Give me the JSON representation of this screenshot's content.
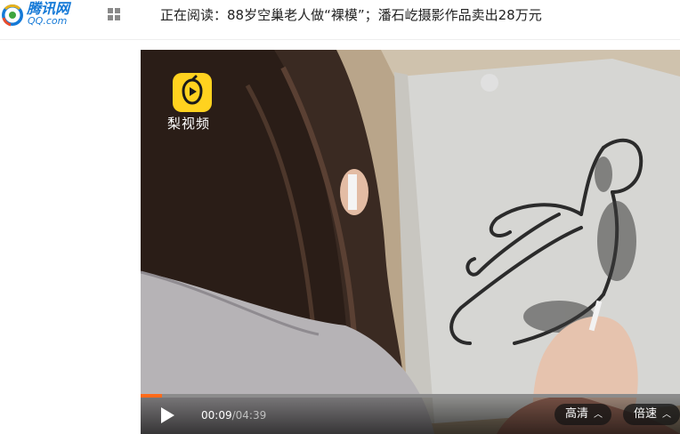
{
  "header": {
    "logo_text": "腾讯网",
    "logo_sub": "QQ.com",
    "menu_icon": "grid-icon",
    "reading_text": "正在阅读：88岁空巢老人做“裸模”；潘石屹摄影作品卖出28万元"
  },
  "video": {
    "brand_label": "梨视频",
    "progress_fraction": 0.039,
    "current_time": "00:09",
    "duration": "/04:39",
    "quality_label": "高清",
    "speed_label": "倍速",
    "play_icon": "play-icon",
    "chevron_icon": "chevron-up-icon"
  },
  "colors": {
    "brand_blue": "#1479d7",
    "progress_orange": "#ff6a1a",
    "pear_yellow": "#ffd21f"
  }
}
